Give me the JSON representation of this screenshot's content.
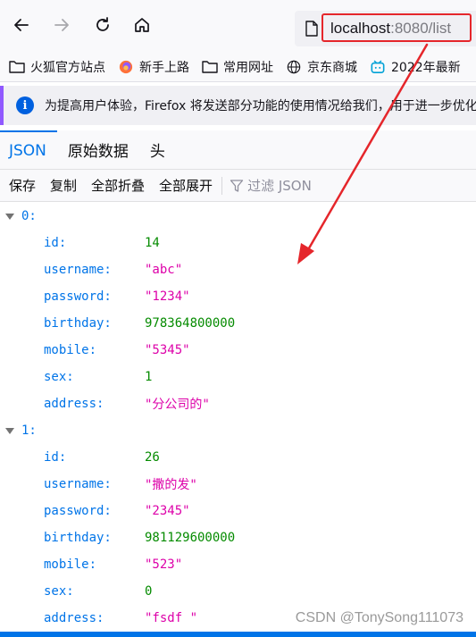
{
  "browser": {
    "url_host": "localhost",
    "url_rest": ":8080/list"
  },
  "bookmarks": [
    {
      "label": "火狐官方站点",
      "icon": "folder-icon"
    },
    {
      "label": "新手上路",
      "icon": "firefox-icon"
    },
    {
      "label": "常用网址",
      "icon": "folder-icon"
    },
    {
      "label": "京东商城",
      "icon": "globe-icon"
    },
    {
      "label": "2022年最新",
      "icon": "bilibili-icon"
    }
  ],
  "notification": {
    "text": "为提高用户体验，Firefox 将发送部分功能的使用情况给我们，用于进一步优化火狐浏览器"
  },
  "tabs": [
    {
      "label": "JSON",
      "active": true
    },
    {
      "label": "原始数据",
      "active": false
    },
    {
      "label": "头",
      "active": false
    }
  ],
  "toolbar": {
    "save": "保存",
    "copy": "复制",
    "collapse_all": "全部折叠",
    "expand_all": "全部展开",
    "filter_placeholder": "过滤 JSON"
  },
  "records": [
    {
      "index": "0:",
      "fields": [
        {
          "key": "id:",
          "value": "14",
          "type": "num"
        },
        {
          "key": "username:",
          "value": "\"abc\"",
          "type": "str"
        },
        {
          "key": "password:",
          "value": "\"1234\"",
          "type": "str"
        },
        {
          "key": "birthday:",
          "value": "978364800000",
          "type": "num"
        },
        {
          "key": "mobile:",
          "value": "\"5345\"",
          "type": "str"
        },
        {
          "key": "sex:",
          "value": "1",
          "type": "num"
        },
        {
          "key": "address:",
          "value": "\"分公司的\"",
          "type": "str"
        }
      ]
    },
    {
      "index": "1:",
      "fields": [
        {
          "key": "id:",
          "value": "26",
          "type": "num"
        },
        {
          "key": "username:",
          "value": "\"撒的发\"",
          "type": "str"
        },
        {
          "key": "password:",
          "value": "\"2345\"",
          "type": "str"
        },
        {
          "key": "birthday:",
          "value": "981129600000",
          "type": "num"
        },
        {
          "key": "mobile:",
          "value": "\"523\"",
          "type": "str"
        },
        {
          "key": "sex:",
          "value": "0",
          "type": "num"
        },
        {
          "key": "address:",
          "value": "\"fsdf \"",
          "type": "str"
        }
      ]
    }
  ],
  "watermark": "CSDN @TonySong111073",
  "colors": {
    "key": "#0074e8",
    "number": "#058b00",
    "string": "#dd00a9",
    "annotation": "#e5262b"
  }
}
